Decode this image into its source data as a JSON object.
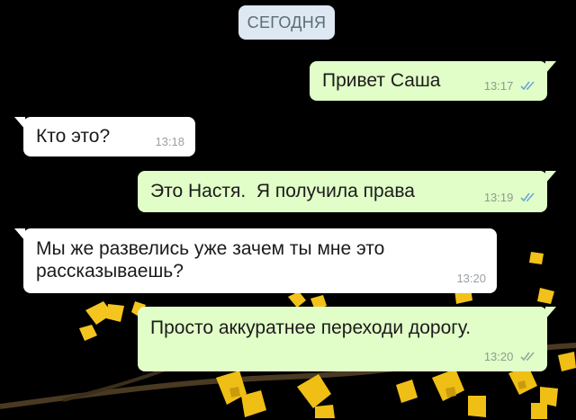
{
  "chat": {
    "date_separator": "СЕГОДНЯ",
    "messages": [
      {
        "direction": "out",
        "text": "Привет Саша",
        "time": "13:17",
        "status_icon": "double-check-icon"
      },
      {
        "direction": "in",
        "text": "Кто это?",
        "time": "13:18"
      },
      {
        "direction": "out",
        "text": "Это Настя.  Я получила права",
        "time": "13:19",
        "status_icon": "double-check-icon"
      },
      {
        "direction": "in",
        "text_line1": "Мы же развелись уже зачем ты мне это",
        "text_line2": "рассказываешь?",
        "time": "13:20"
      },
      {
        "direction": "out",
        "text": "Просто аккуратнее переходи дорогу.",
        "time": "13:20",
        "status_icon": "double-check-icon"
      }
    ]
  },
  "colors": {
    "background": "#000000",
    "outgoing_bubble": "#e1fec8",
    "incoming_bubble": "#ffffff",
    "date_chip": "#dde8f2",
    "read_ticks": "#6aa9d6",
    "sent_ticks": "#9aa59a",
    "flowers": "#f2c21b",
    "branch": "#4a3a22"
  }
}
